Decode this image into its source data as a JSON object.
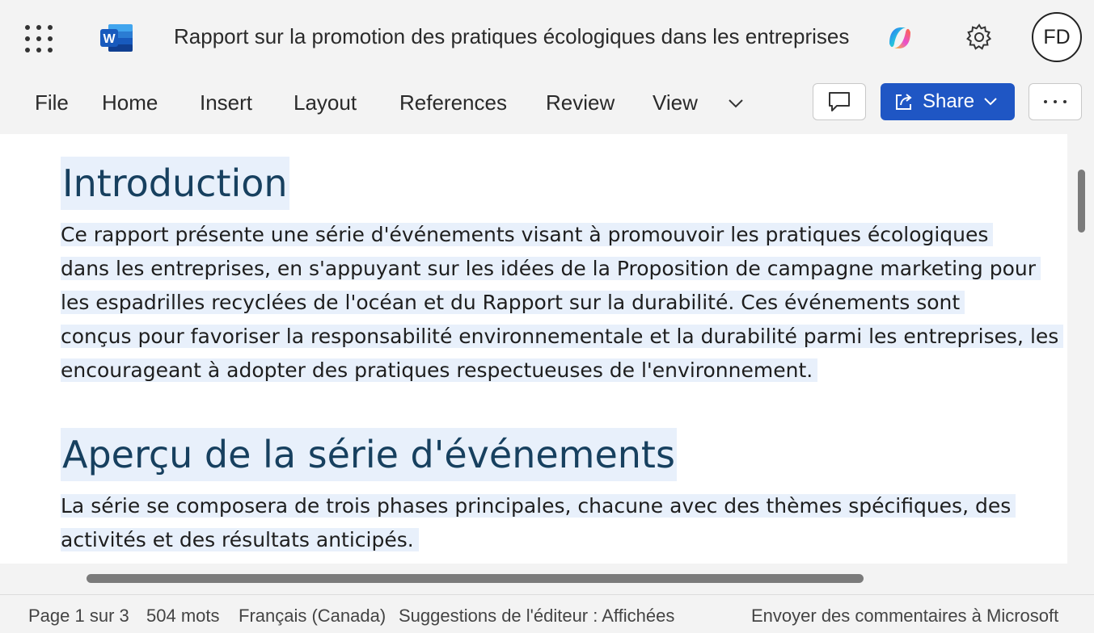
{
  "app": {
    "document_title": "Rapport sur la promotion des pratiques écologiques dans les entreprises",
    "user_initials": "FD",
    "accent_color": "#1f56c4",
    "icons": [
      "waffle-icon",
      "word-logo-icon",
      "copilot-icon",
      "settings-gear-icon"
    ]
  },
  "ribbon": {
    "tabs": [
      "File",
      "Home",
      "Insert",
      "Layout",
      "References",
      "Review",
      "View"
    ],
    "share_label": "Share"
  },
  "document": {
    "heading1": "Introduction",
    "para1_lines": [
      "Ce rapport présente une série d'événements visant à promouvoir les pratiques écologiques",
      "dans les entreprises, en s'appuyant sur les idées de la Proposition de campagne marketing pour",
      "les espadrilles recyclées de l'océan et du Rapport sur la durabilité. Ces événements sont",
      "conçus pour favoriser la responsabilité environnementale et la durabilité parmi les entreprises, les",
      "encourageant à adopter des pratiques respectueuses de l'environnement."
    ],
    "heading2": "Aperçu de la série d'événements",
    "para2_lines": [
      "La série se composera de trois phases principales, chacune avec des thèmes spécifiques, des",
      "activités et des résultats anticipés."
    ],
    "highlight_color": "#e8f0fb"
  },
  "status": {
    "page": "Page 1 sur 3",
    "words": "504 mots",
    "language": "Français (Canada)",
    "editor": "Suggestions de l'éditeur : Affichées",
    "feedback": "Envoyer des commentaires à Microsoft"
  }
}
